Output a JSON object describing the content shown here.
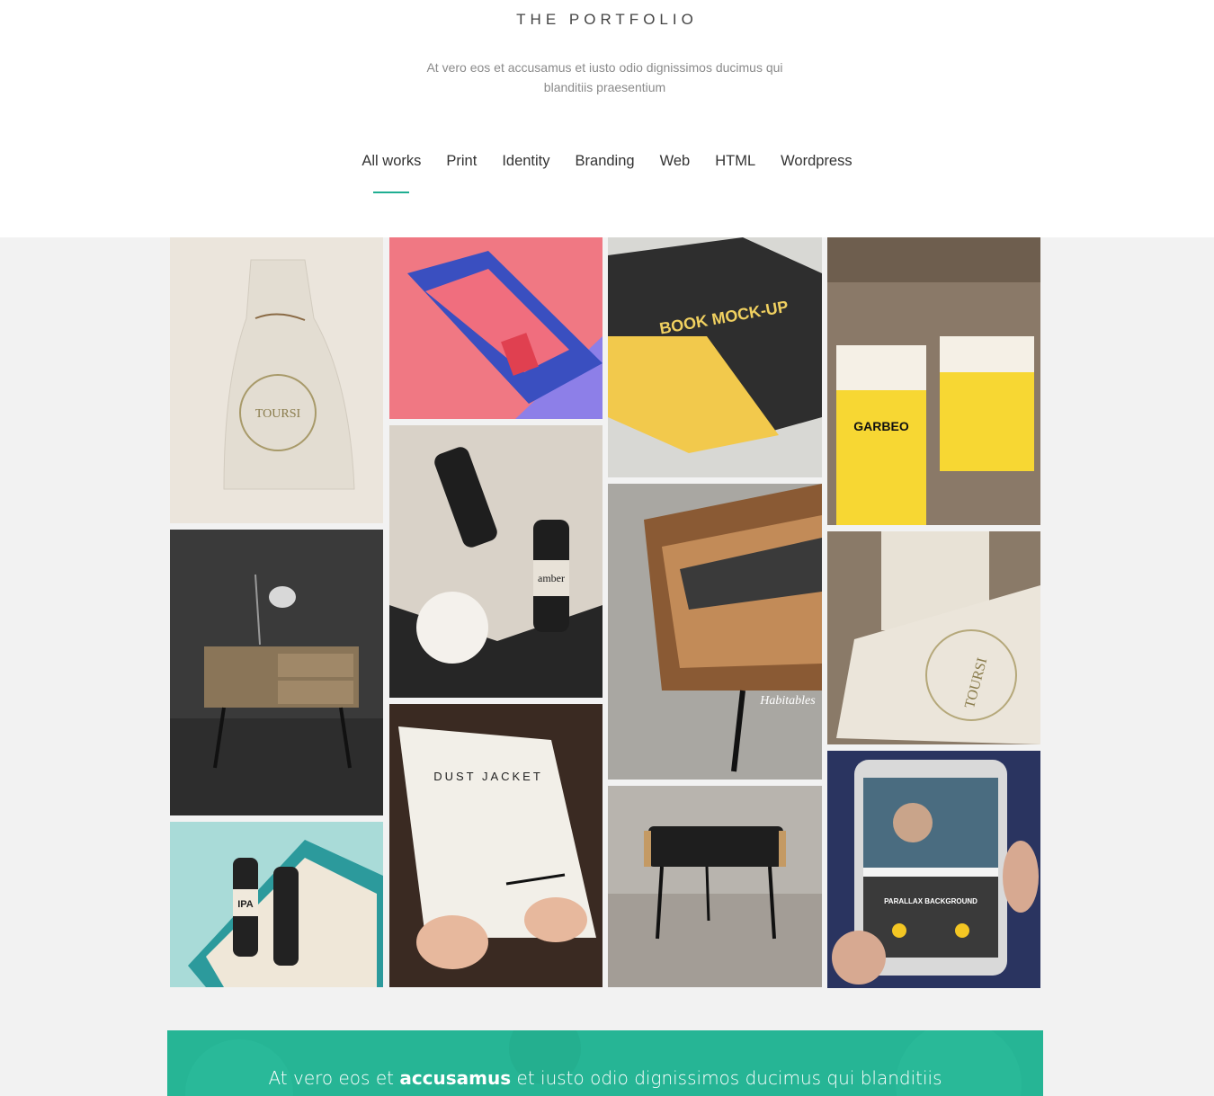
{
  "header": {
    "title": "THE PORTFOLIO",
    "subtitle": "At vero eos et accusamus et iusto odio dignissimos ducimus qui blanditiis praesentium"
  },
  "filters": [
    {
      "label": "All works",
      "active": true
    },
    {
      "label": "Print",
      "active": false
    },
    {
      "label": "Identity",
      "active": false
    },
    {
      "label": "Branding",
      "active": false
    },
    {
      "label": "Web",
      "active": false
    },
    {
      "label": "HTML",
      "active": false
    },
    {
      "label": "Wordpress",
      "active": false
    }
  ],
  "colors": {
    "accent": "#1fae92",
    "banner": "#26b595",
    "gallery_bg": "#f2f2f2"
  },
  "gallery": {
    "items": [
      {
        "subject": "paper-bag-tours-icon",
        "text": "TOURSI"
      },
      {
        "subject": "chair-nightstand-icon"
      },
      {
        "subject": "beer-box-icon",
        "text": "IPA"
      },
      {
        "subject": "book-cover-icon"
      },
      {
        "subject": "amber-bottles-icon",
        "text": "amber"
      },
      {
        "subject": "dust-jacket-book-icon",
        "text": "DUST JACKET"
      },
      {
        "subject": "book-mockup-icon",
        "text": "BOOK MOCK-UP"
      },
      {
        "subject": "wooden-tray-icon",
        "text": "Habitables"
      },
      {
        "subject": "stool-icon"
      },
      {
        "subject": "garbeo-bags-icon",
        "text": "GARBEO"
      },
      {
        "subject": "paper-bag-closeup-icon",
        "text": "TOURSI"
      },
      {
        "subject": "tablet-mockup-icon",
        "text": "PARALLAX BACKGROUND"
      }
    ]
  },
  "banner": {
    "text_start": "At vero eos et ",
    "text_bold": "accusamus",
    "text_end": " et iusto odio dignissimos ducimus qui blanditiis"
  }
}
